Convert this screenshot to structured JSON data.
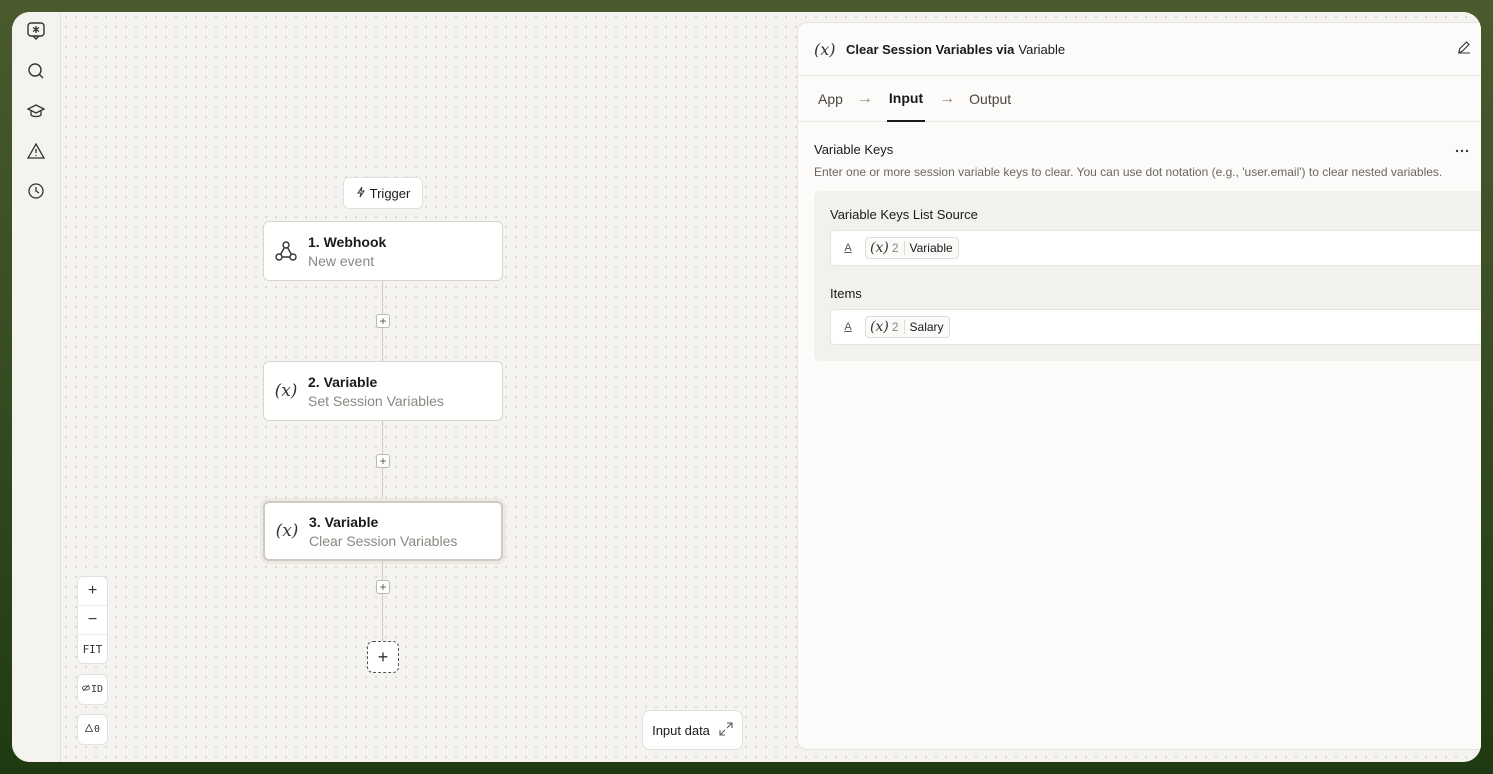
{
  "rail": {
    "icons": [
      "logo-icon",
      "search-icon",
      "graduation-cap-icon",
      "warning-icon",
      "history-icon"
    ]
  },
  "flow": {
    "trigger_label": "Trigger",
    "nodes": [
      {
        "title": "1. Webhook",
        "subtitle": "New event",
        "icon": "webhook-icon"
      },
      {
        "title": "2. Variable",
        "subtitle": "Set Session Variables",
        "icon": "(x)"
      },
      {
        "title": "3. Variable",
        "subtitle": "Clear Session Variables",
        "icon": "(x)"
      }
    ],
    "add_symbol": "+"
  },
  "zoom": {
    "zoom_in": "+",
    "zoom_out": "−",
    "fit": "FIT",
    "id_toggle": "ID",
    "warnings_count": "0"
  },
  "input_data": {
    "label": "Input data"
  },
  "panel": {
    "icon": "(x)",
    "title": "Clear Session Variables via",
    "title_app": "Variable",
    "tabs": [
      "App",
      "Input",
      "Output"
    ],
    "active_tab": "Input",
    "section": {
      "title": "Variable Keys",
      "description": "Enter one or more session variable keys to clear. You can use dot notation (e.g., 'user.email') to clear nested variables."
    },
    "fields": [
      {
        "label": "Variable Keys List Source",
        "chip_icon": "(x)",
        "chip_num": "2",
        "chip_label": "Variable"
      },
      {
        "label": "Items",
        "chip_icon": "(x)",
        "chip_num": "2",
        "chip_label": "Salary"
      }
    ],
    "text_type_glyph": "A"
  }
}
